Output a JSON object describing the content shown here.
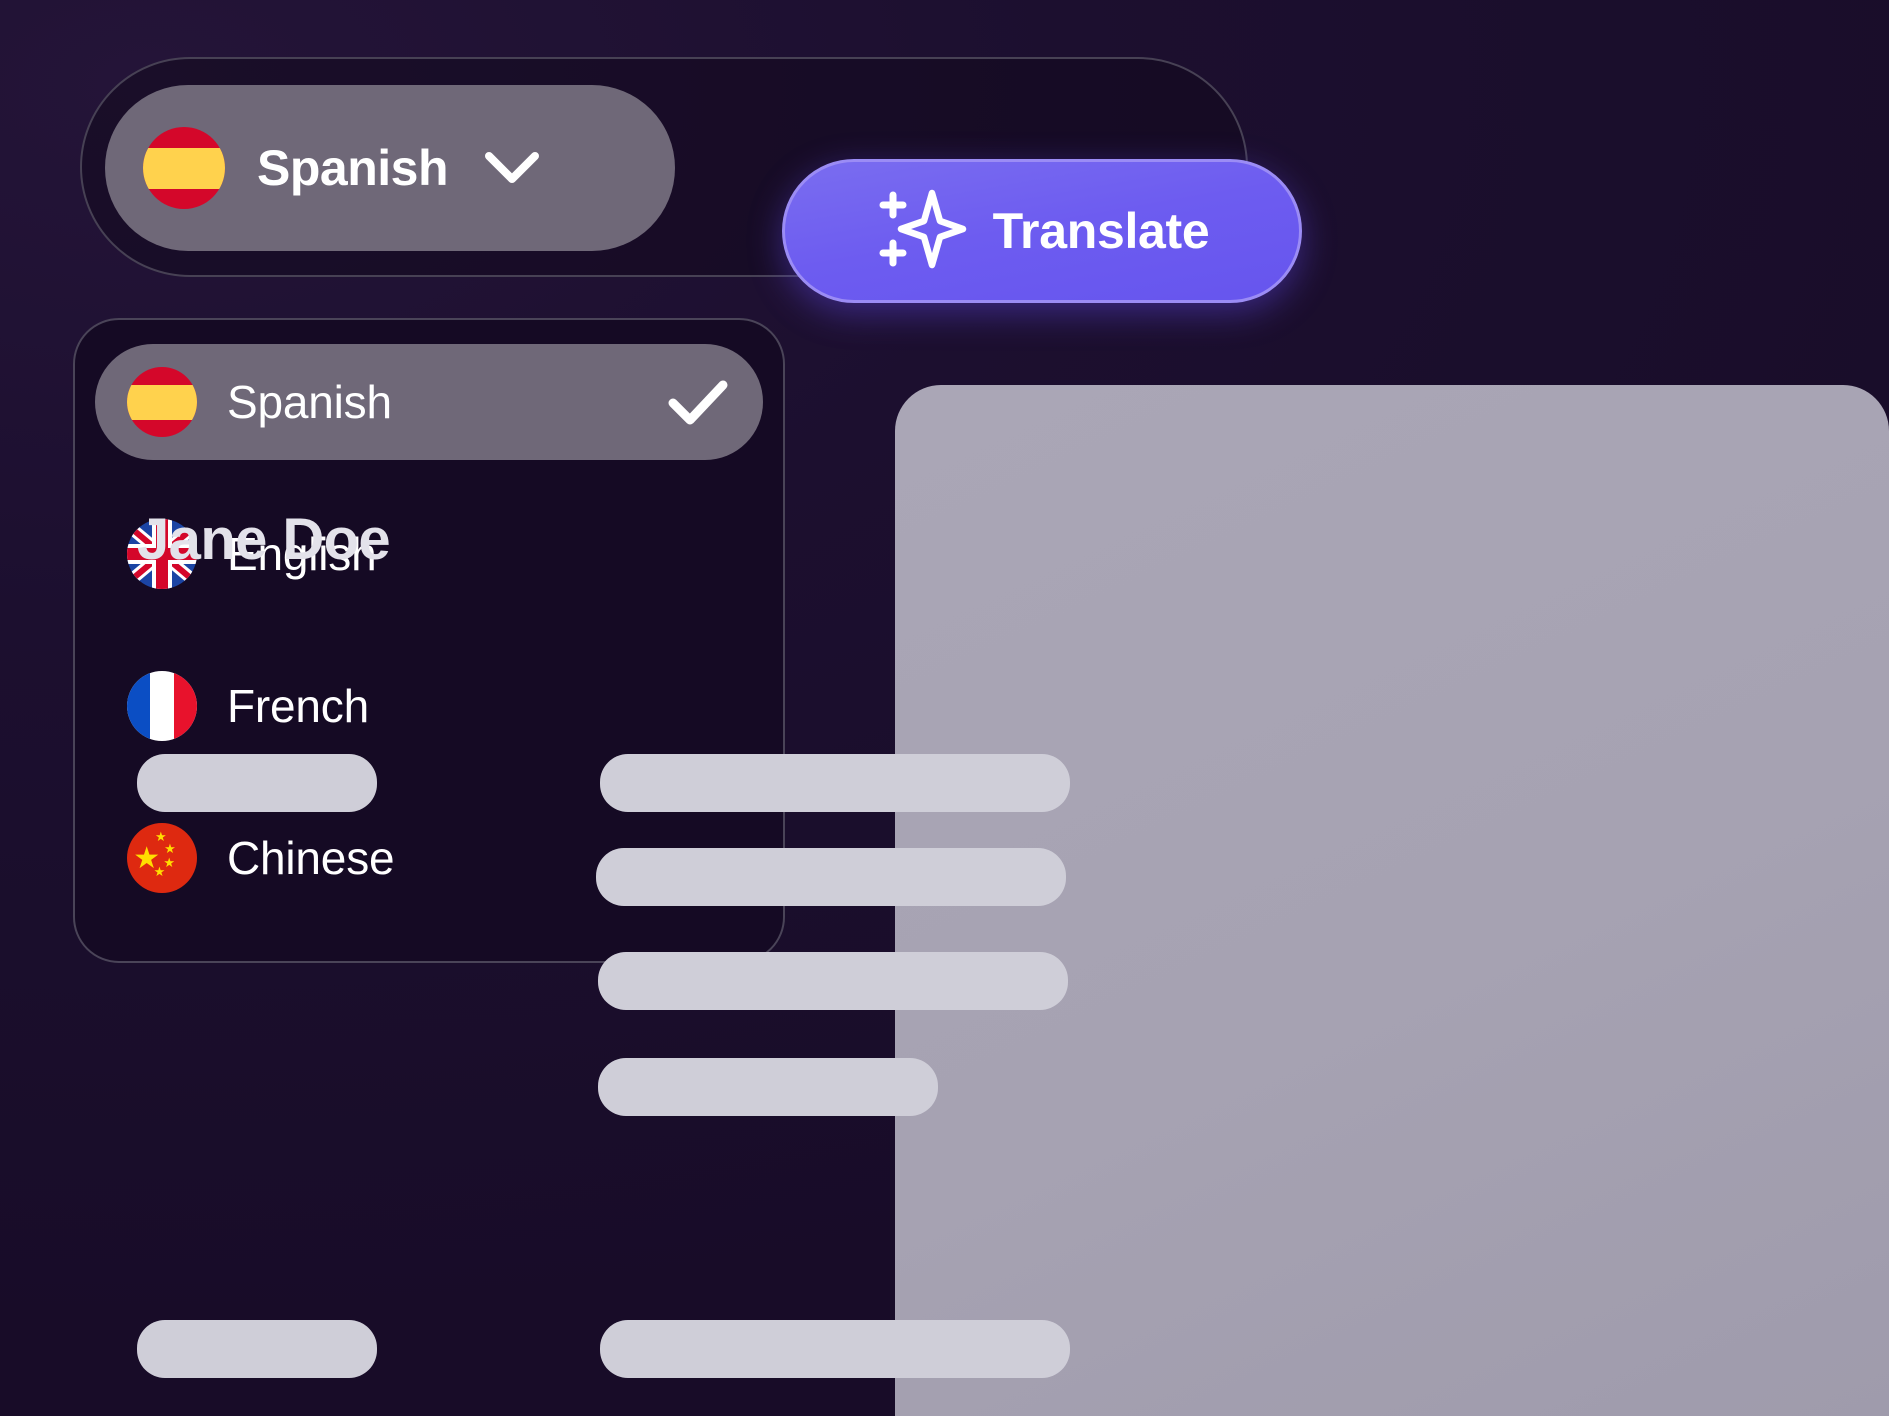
{
  "theme": {
    "background": "#1a0e2e",
    "panel_background": "#150a24",
    "accent": "#6d5cf0",
    "accent_border": "#9b8cf5",
    "pill_background": "#6f6878",
    "card_background": "#a6a2b2",
    "skeleton_color": "#cfced8",
    "text_primary": "#ffffff",
    "card_text": "#e3e2ea",
    "border": "#474154"
  },
  "toolbar": {
    "language_select": {
      "name": "language-select",
      "selected_label": "Spanish",
      "flag": "spain-flag-icon",
      "chevron_icon": "chevron-down-icon"
    },
    "translate_button": {
      "label": "Translate",
      "icon": "sparkle-icon"
    }
  },
  "dropdown": {
    "name": "language-dropdown",
    "check_icon": "check-icon",
    "items": [
      {
        "label": "Spanish",
        "flag": "spain-flag-icon",
        "code": "es",
        "selected": true
      },
      {
        "label": "English",
        "flag": "uk-flag-icon",
        "code": "gb",
        "selected": false
      },
      {
        "label": "French",
        "flag": "france-flag-icon",
        "code": "fr",
        "selected": false
      },
      {
        "label": "Chinese",
        "flag": "china-flag-icon",
        "code": "cn",
        "selected": false
      }
    ]
  },
  "content_card": {
    "title": "Jane Doe",
    "skeleton_rows": 7
  }
}
